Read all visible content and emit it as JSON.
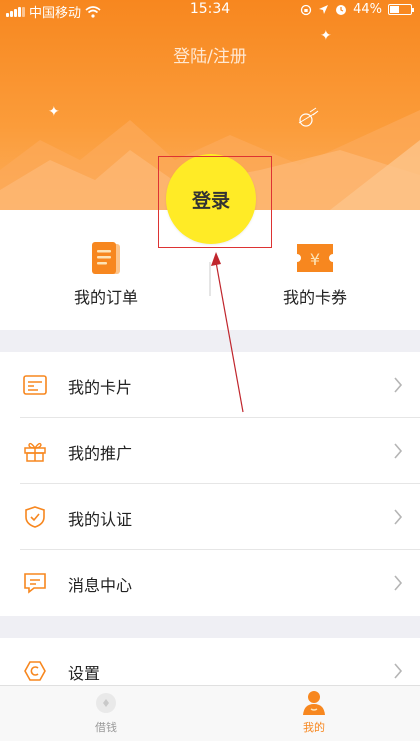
{
  "status_bar": {
    "carrier": "中国移动",
    "time": "15:34",
    "battery": "44%",
    "icons": [
      "signal-icon",
      "wifi-icon",
      "rotation-lock-icon",
      "location-icon",
      "alarm-icon",
      "battery-icon"
    ]
  },
  "header": {
    "title": "登陆/注册",
    "login_label": "登录",
    "accent_color": "#f7871f",
    "login_color": "#ffeb26"
  },
  "quick_links": [
    {
      "label": "我的订单",
      "icon": "order-icon"
    },
    {
      "label": "我的卡券",
      "icon": "coupon-icon"
    }
  ],
  "menu_group_1": [
    {
      "label": "我的卡片",
      "icon": "card-icon"
    },
    {
      "label": "我的推广",
      "icon": "gift-icon"
    },
    {
      "label": "我的认证",
      "icon": "shield-check-icon"
    },
    {
      "label": "消息中心",
      "icon": "message-icon"
    }
  ],
  "menu_group_2": [
    {
      "label": "设置",
      "icon": "settings-icon"
    }
  ],
  "tabbar": {
    "tabs": [
      {
        "label": "借钱",
        "icon": "borrow-icon",
        "active": false
      },
      {
        "label": "我的",
        "icon": "user-icon",
        "active": true
      }
    ],
    "active_color": "#f7871f",
    "inactive_color": "#999999"
  }
}
